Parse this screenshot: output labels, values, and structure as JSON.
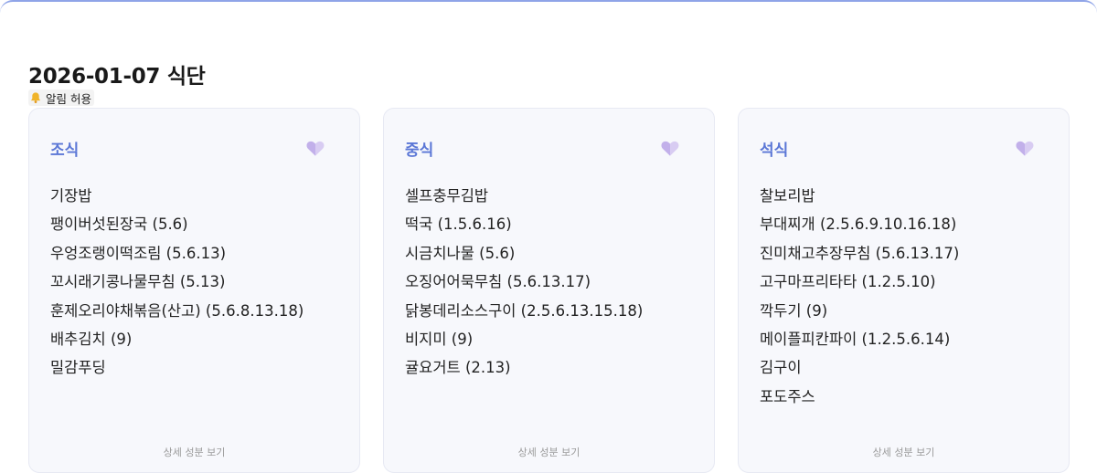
{
  "page": {
    "title": "2026-01-07 식단",
    "notification_label": "알림 허용",
    "notification_icon": "bell-icon"
  },
  "meals": [
    {
      "name": "조식",
      "favorite_icon": "heart-icon",
      "items": [
        "기장밥",
        "팽이버섯된장국 (5.6)",
        "우엉조랭이떡조림 (5.6.13)",
        "꼬시래기콩나물무침 (5.13)",
        "훈제오리야채볶음(산고) (5.6.8.13.18)",
        "배추김치 (9)",
        "밀감푸딩"
      ],
      "detail_label": "상세 성분 보기"
    },
    {
      "name": "중식",
      "favorite_icon": "heart-icon",
      "items": [
        "셀프충무김밥",
        "떡국 (1.5.6.16)",
        "시금치나물 (5.6)",
        "오징어어묵무침 (5.6.13.17)",
        "닭봉데리소스구이 (2.5.6.13.15.18)",
        "비지미 (9)",
        "귤요거트 (2.13)"
      ],
      "detail_label": "상세 성분 보기"
    },
    {
      "name": "석식",
      "favorite_icon": "heart-icon",
      "items": [
        "찰보리밥",
        "부대찌개 (2.5.6.9.10.16.18)",
        "진미채고추장무침 (5.6.13.17)",
        "고구마프리타타 (1.2.5.10)",
        "깍두기 (9)",
        "메이플피칸파이 (1.2.5.6.14)",
        "김구이",
        "포도주스"
      ],
      "detail_label": "상세 성분 보기"
    }
  ],
  "colors": {
    "accent": "#5b77d6",
    "card_bg": "#f7f8fc",
    "heart": "#c9b8ec",
    "top_border": "#8fa4e8"
  }
}
